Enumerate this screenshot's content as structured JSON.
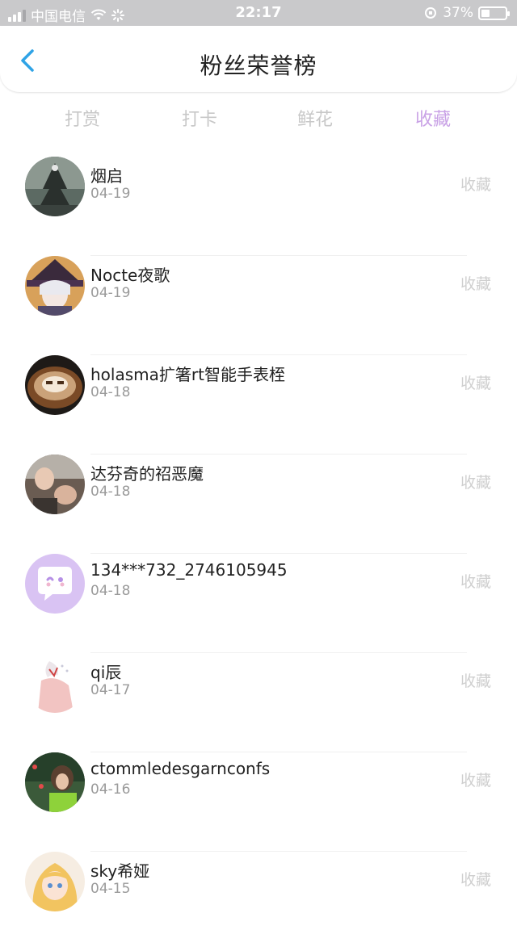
{
  "status_bar": {
    "carrier": "中国电信",
    "time": "22:17",
    "battery_text": "37%",
    "battery_level": 0.37
  },
  "nav": {
    "title": "粉丝荣誉榜",
    "back_icon": "chevron-left-icon"
  },
  "tabs": [
    {
      "label": "打赏",
      "active": false
    },
    {
      "label": "打卡",
      "active": false
    },
    {
      "label": "鲜花",
      "active": false
    },
    {
      "label": "收藏",
      "active": true
    }
  ],
  "colors": {
    "accent": "#c9a2e6",
    "back": "#2fa3e6",
    "action": "#cfcfcf",
    "date": "#9a9a9a"
  },
  "fans": [
    {
      "name": "烟启",
      "date": "04-19",
      "action": "收藏",
      "avatar_icon": "dark-forest-avatar"
    },
    {
      "name": "Nocte夜歌",
      "date": "04-19",
      "action": "收藏",
      "avatar_icon": "anime-witch-avatar"
    },
    {
      "name": "holasma扩箸rt智能手表桎",
      "date": "04-18",
      "action": "收藏",
      "avatar_icon": "latte-art-avatar"
    },
    {
      "name": "达芬奇的祒恶魔",
      "date": "04-18",
      "action": "收藏",
      "avatar_icon": "photo-avatar"
    },
    {
      "name": "134***732_2746105945",
      "date": "04-18",
      "action": "收藏",
      "avatar_icon": "default-chat-avatar"
    },
    {
      "name": "qi辰",
      "date": "04-17",
      "action": "收藏",
      "avatar_icon": "sketch-girl-avatar"
    },
    {
      "name": "ctommledesgarnconfs",
      "date": "04-16",
      "action": "收藏",
      "avatar_icon": "green-photo-avatar"
    },
    {
      "name": "sky希娅",
      "date": "04-15",
      "action": "收藏",
      "avatar_icon": "anime-blonde-avatar"
    }
  ]
}
